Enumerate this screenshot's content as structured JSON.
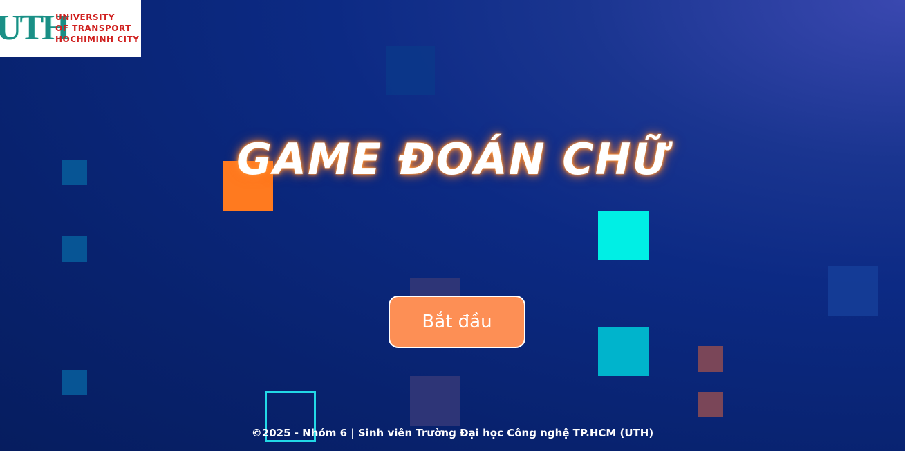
{
  "logo": {
    "mark": "UTH",
    "lines": [
      "UNIVERSITY",
      "OF TRANSPORT",
      "HOCHIMINH CITY"
    ]
  },
  "title": "GAME ĐOÁN CHỮ",
  "start_button": {
    "label": "Bắt đầu"
  },
  "footer": "©2025 - Nhóm 6 | Sinh viên Trường Đại học Công nghệ TP.HCM (UTH)",
  "colors": {
    "accent_orange": "#fd8f55",
    "square_orange": "#ff7a1f",
    "square_cyan": "#00efe5",
    "square_teal": "#00b4cc",
    "square_maroon": "#7a4658",
    "background": "#0c2a84"
  }
}
